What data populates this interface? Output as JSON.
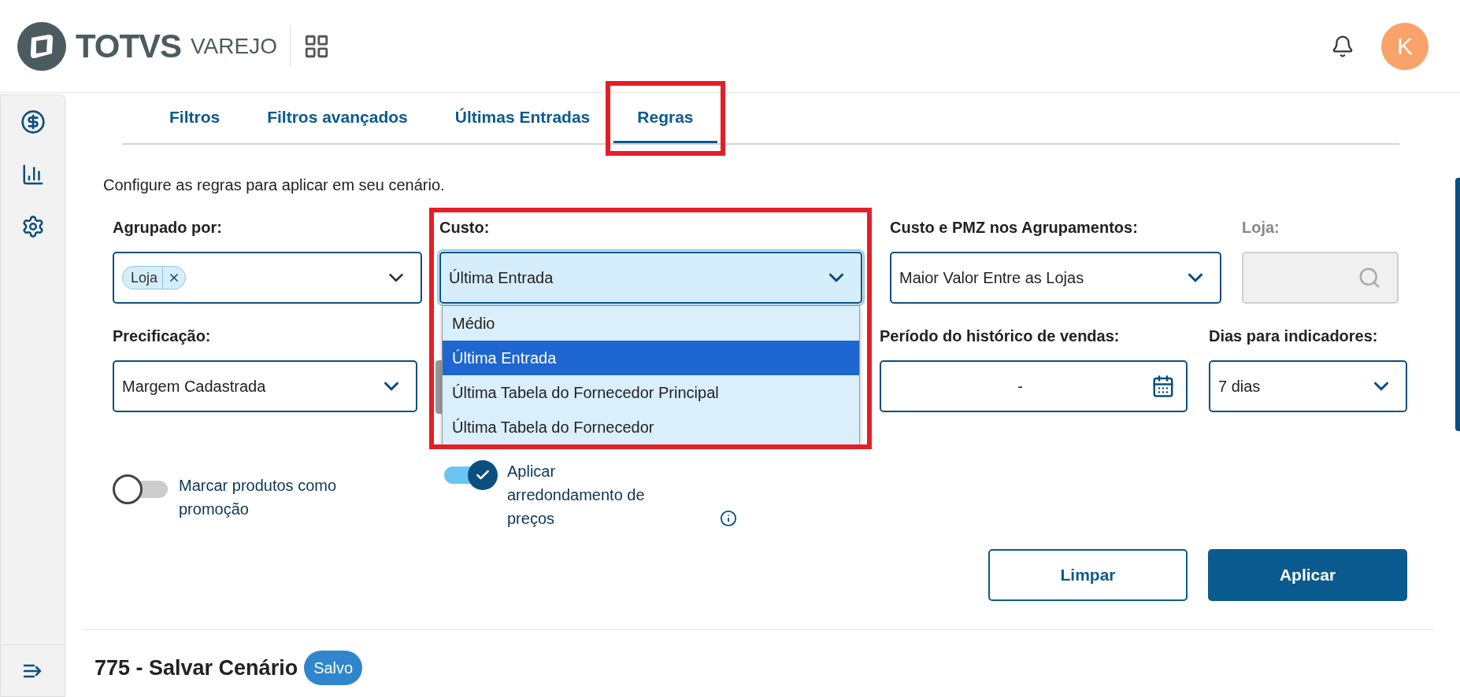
{
  "header": {
    "brand": "TOTVS",
    "product": "VAREJO",
    "avatar_initial": "K"
  },
  "tabs": [
    {
      "label": "Filtros",
      "selected": false,
      "highlighted": false
    },
    {
      "label": "Filtros avançados",
      "selected": false,
      "highlighted": false
    },
    {
      "label": "Últimas Entradas",
      "selected": false,
      "highlighted": false
    },
    {
      "label": "Regras",
      "selected": true,
      "highlighted": true
    }
  ],
  "description": "Configure as regras para aplicar em seu cenário.",
  "fields_row_1": [
    {
      "kind": "multiselect",
      "label": "Agrupado por:",
      "chips": [
        "Loja"
      ],
      "highlighted": false,
      "disabled": false
    },
    {
      "kind": "select",
      "label": "Custo:",
      "value": "Última Entrada",
      "expanded": true,
      "highlighted": true,
      "disabled": false,
      "options": [
        {
          "label": "Médio",
          "selected": false
        },
        {
          "label": "Última Entrada",
          "selected": true
        },
        {
          "label": "Última Tabela do Fornecedor Principal",
          "selected": false
        },
        {
          "label": "Última Tabela do Fornecedor",
          "selected": false
        }
      ]
    },
    {
      "kind": "select",
      "label": "Custo e PMZ nos Agrupamentos:",
      "value": "Maior Valor Entre as Lojas",
      "highlighted": false,
      "disabled": false
    },
    {
      "kind": "search",
      "label": "Loja:",
      "highlighted": false,
      "disabled": true
    }
  ],
  "fields_row_2": [
    {
      "kind": "select",
      "label": "Precificação:",
      "value": "Margem Cadastrada",
      "highlighted": false,
      "disabled": false
    },
    {
      "kind": "covered"
    },
    {
      "kind": "date",
      "label": "Período do histórico de vendas:",
      "value": "-",
      "highlighted": false,
      "disabled": false
    },
    {
      "kind": "select",
      "label": "Dias para indicadores:",
      "value": "7 dias",
      "highlighted": false,
      "disabled": false
    }
  ],
  "toggles": [
    {
      "label": "Marcar produtos como promoção",
      "on": false
    },
    {
      "label": "Aplicar arredondamento de preços",
      "on": true,
      "info": true
    }
  ],
  "buttons": [
    {
      "label": "Limpar",
      "kind": "secondary"
    },
    {
      "label": "Aplicar",
      "kind": "primary"
    }
  ],
  "footer": {
    "title": "775 - Salvar Cenário",
    "badge": "Salvo"
  }
}
